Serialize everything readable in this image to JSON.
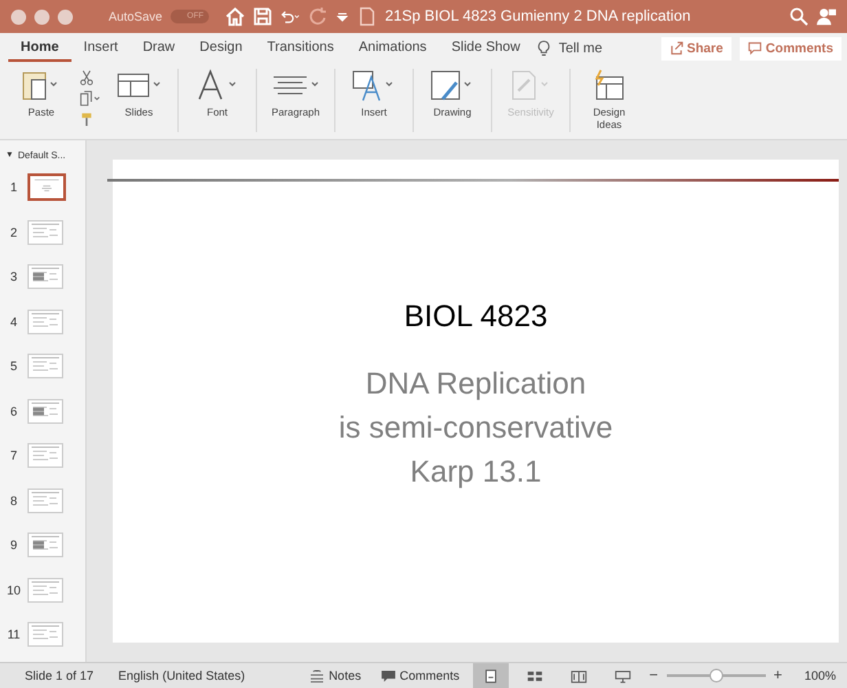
{
  "window": {
    "title": "21Sp BIOL 4823 Gumienny 2 DNA replication",
    "autosave": {
      "label": "AutoSave",
      "on": false,
      "state_text": "OFF"
    }
  },
  "tabs": [
    {
      "label": "Home",
      "selected": true
    },
    {
      "label": "Insert",
      "selected": false
    },
    {
      "label": "Draw",
      "selected": false
    },
    {
      "label": "Design",
      "selected": false
    },
    {
      "label": "Transitions",
      "selected": false
    },
    {
      "label": "Animations",
      "selected": false
    },
    {
      "label": "Slide Show",
      "selected": false
    }
  ],
  "tell_me": "Tell me",
  "share": "Share",
  "comments_button": "Comments",
  "ribbon": [
    {
      "kind": "paste",
      "label": "Paste",
      "disabled": false
    },
    {
      "kind": "slides",
      "label": "Slides",
      "disabled": false
    },
    {
      "kind": "font",
      "label": "Font",
      "disabled": false
    },
    {
      "kind": "paragraph",
      "label": "Paragraph",
      "disabled": false
    },
    {
      "kind": "insert",
      "label": "Insert",
      "disabled": false
    },
    {
      "kind": "drawing",
      "label": "Drawing",
      "disabled": false
    },
    {
      "kind": "sensitivity",
      "label": "Sensitivity",
      "disabled": true
    },
    {
      "kind": "design",
      "label": "Design Ideas",
      "disabled": false
    }
  ],
  "sidebar": {
    "section_toggle": "▼",
    "section": "Default S...",
    "slides": [
      {
        "number": "1",
        "selected": true
      },
      {
        "number": "2",
        "selected": false
      },
      {
        "number": "3",
        "selected": false
      },
      {
        "number": "4",
        "selected": false
      },
      {
        "number": "5",
        "selected": false
      },
      {
        "number": "6",
        "selected": false
      },
      {
        "number": "7",
        "selected": false
      },
      {
        "number": "8",
        "selected": false
      },
      {
        "number": "9",
        "selected": false
      },
      {
        "number": "10",
        "selected": false
      },
      {
        "number": "11",
        "selected": false
      }
    ]
  },
  "slide": {
    "title": "BIOL 4823",
    "subtitle_lines": [
      "DNA Replication",
      "is semi-conservative",
      "Karp 13.1"
    ]
  },
  "status_bar": {
    "slide_count": "Slide 1 of 17",
    "language": "English (United States)",
    "notes": "Notes",
    "comments": "Comments",
    "views": [
      {
        "kind": "normal",
        "selected": true
      },
      {
        "kind": "sorter",
        "selected": false
      },
      {
        "kind": "reading",
        "selected": false
      },
      {
        "kind": "show",
        "selected": false
      }
    ],
    "zoom": {
      "out": "−",
      "in": "+",
      "level": 0.5,
      "reading": "100%"
    }
  }
}
